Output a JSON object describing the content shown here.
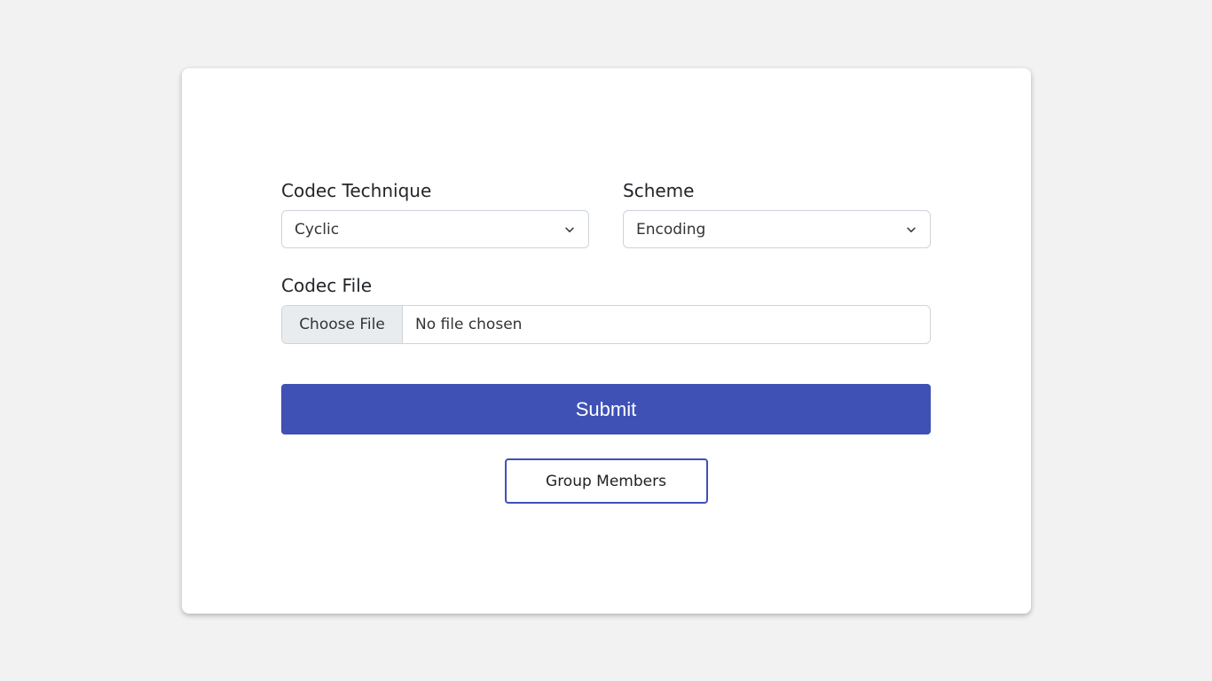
{
  "form": {
    "codec_technique": {
      "label": "Codec Technique",
      "selected": "Cyclic"
    },
    "scheme": {
      "label": "Scheme",
      "selected": "Encoding"
    },
    "codec_file": {
      "label": "Codec File",
      "button_label": "Choose File",
      "status": "No file chosen"
    },
    "submit_label": "Submit",
    "group_members_label": "Group Members"
  },
  "icons": {
    "select_arrow": "chevron-down-icon"
  },
  "colors": {
    "accent": "#3f51b5",
    "background": "#f2f2f2",
    "card": "#ffffff"
  }
}
